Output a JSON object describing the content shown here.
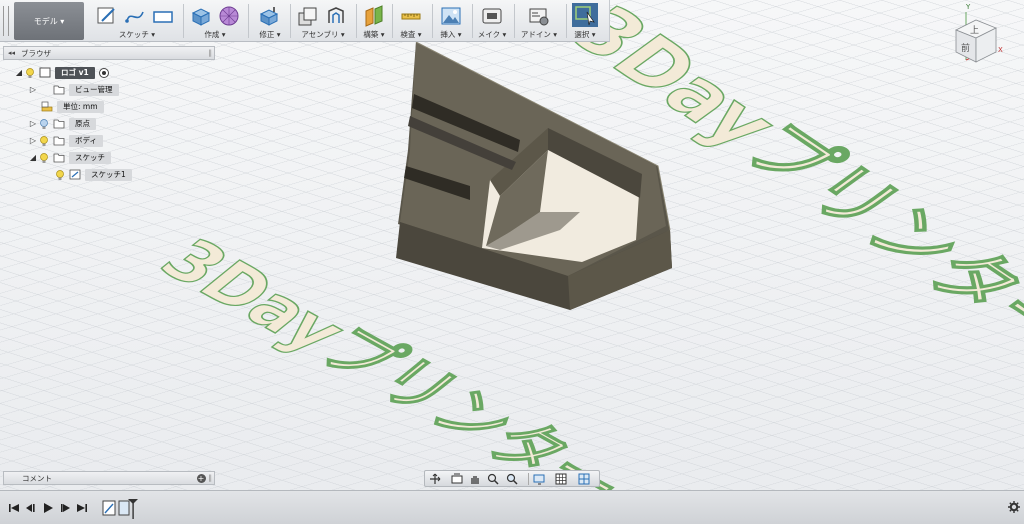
{
  "workspace": {
    "label": "モデル ▾"
  },
  "toolbar": {
    "groups": [
      {
        "label": "スケッチ ▾"
      },
      {
        "label": "作成 ▾"
      },
      {
        "label": "修正 ▾"
      },
      {
        "label": "アセンブリ ▾"
      },
      {
        "label": "構築 ▾"
      },
      {
        "label": "検査 ▾"
      },
      {
        "label": "挿入 ▾"
      },
      {
        "label": "メイク ▾"
      },
      {
        "label": "アドイン ▾"
      },
      {
        "label": "選択 ▾"
      }
    ]
  },
  "browser": {
    "title": "ブラウザ",
    "collapse_glyph": "◂◂",
    "items": [
      {
        "label": "ロゴ v1"
      },
      {
        "label": "ビュー管理"
      },
      {
        "label": "単位: mm"
      },
      {
        "label": "原点"
      },
      {
        "label": "ボディ"
      },
      {
        "label": "スケッチ"
      },
      {
        "label": "スケッチ1"
      }
    ]
  },
  "comments": {
    "title": "コメント"
  },
  "viewcube": {
    "top_label": "上",
    "front_label": "前",
    "x_axis": "X",
    "y_axis": "Y"
  },
  "canvas": {
    "text_front": "3Dayプリンター",
    "text_back": "3Dayプリンター"
  },
  "colors": {
    "model_dark": "#4f4b40",
    "model_mid": "#6b6658",
    "model_face_light": "#f1ebdf",
    "sketch_fill": "#f3ead7",
    "sketch_stroke": "#6aa863",
    "selection_accent": "#3a7fc1"
  },
  "icons": {
    "navbar": [
      "orbit-icon",
      "look-at-icon",
      "pan-icon",
      "zoom-icon",
      "zoom-window-icon",
      "display-icon",
      "grid-icon",
      "viewports-icon"
    ],
    "timeline": [
      "first-icon",
      "prev-icon",
      "play-icon",
      "next-icon",
      "last-icon"
    ]
  }
}
